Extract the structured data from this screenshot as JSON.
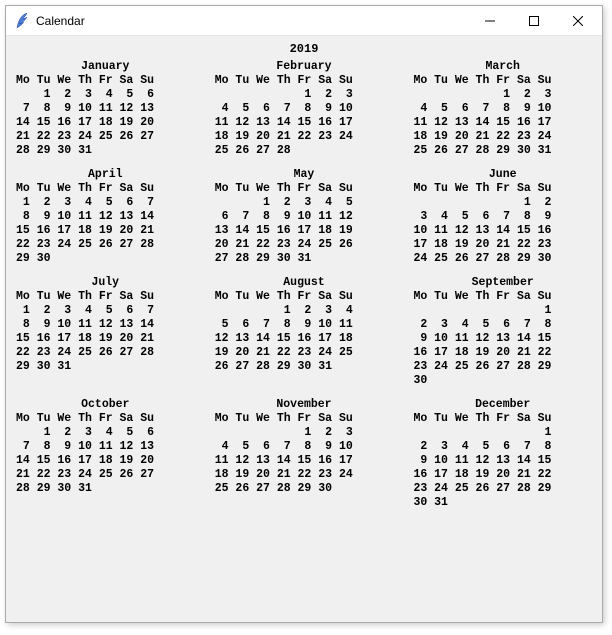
{
  "window": {
    "title": "Calendar",
    "icon": "feather-icon"
  },
  "calendar": {
    "year": "2019",
    "day_header": "Mo Tu We Th Fr Sa Su",
    "months": [
      {
        "name": "January",
        "weeks": [
          "    1  2  3  4  5  6",
          " 7  8  9 10 11 12 13",
          "14 15 16 17 18 19 20",
          "21 22 23 24 25 26 27",
          "28 29 30 31"
        ]
      },
      {
        "name": "February",
        "weeks": [
          "             1  2  3",
          " 4  5  6  7  8  9 10",
          "11 12 13 14 15 16 17",
          "18 19 20 21 22 23 24",
          "25 26 27 28"
        ]
      },
      {
        "name": "March",
        "weeks": [
          "             1  2  3",
          " 4  5  6  7  8  9 10",
          "11 12 13 14 15 16 17",
          "18 19 20 21 22 23 24",
          "25 26 27 28 29 30 31"
        ]
      },
      {
        "name": "April",
        "weeks": [
          " 1  2  3  4  5  6  7",
          " 8  9 10 11 12 13 14",
          "15 16 17 18 19 20 21",
          "22 23 24 25 26 27 28",
          "29 30"
        ]
      },
      {
        "name": "May",
        "weeks": [
          "       1  2  3  4  5",
          " 6  7  8  9 10 11 12",
          "13 14 15 16 17 18 19",
          "20 21 22 23 24 25 26",
          "27 28 29 30 31"
        ]
      },
      {
        "name": "June",
        "weeks": [
          "                1  2",
          " 3  4  5  6  7  8  9",
          "10 11 12 13 14 15 16",
          "17 18 19 20 21 22 23",
          "24 25 26 27 28 29 30"
        ]
      },
      {
        "name": "July",
        "weeks": [
          " 1  2  3  4  5  6  7",
          " 8  9 10 11 12 13 14",
          "15 16 17 18 19 20 21",
          "22 23 24 25 26 27 28",
          "29 30 31"
        ]
      },
      {
        "name": "August",
        "weeks": [
          "          1  2  3  4",
          " 5  6  7  8  9 10 11",
          "12 13 14 15 16 17 18",
          "19 20 21 22 23 24 25",
          "26 27 28 29 30 31"
        ]
      },
      {
        "name": "September",
        "weeks": [
          "                   1",
          " 2  3  4  5  6  7  8",
          " 9 10 11 12 13 14 15",
          "16 17 18 19 20 21 22",
          "23 24 25 26 27 28 29",
          "30"
        ]
      },
      {
        "name": "October",
        "weeks": [
          "    1  2  3  4  5  6",
          " 7  8  9 10 11 12 13",
          "14 15 16 17 18 19 20",
          "21 22 23 24 25 26 27",
          "28 29 30 31"
        ]
      },
      {
        "name": "November",
        "weeks": [
          "             1  2  3",
          " 4  5  6  7  8  9 10",
          "11 12 13 14 15 16 17",
          "18 19 20 21 22 23 24",
          "25 26 27 28 29 30"
        ]
      },
      {
        "name": "December",
        "weeks": [
          "                   1",
          " 2  3  4  5  6  7  8",
          " 9 10 11 12 13 14 15",
          "16 17 18 19 20 21 22",
          "23 24 25 26 27 28 29",
          "30 31"
        ]
      }
    ]
  }
}
